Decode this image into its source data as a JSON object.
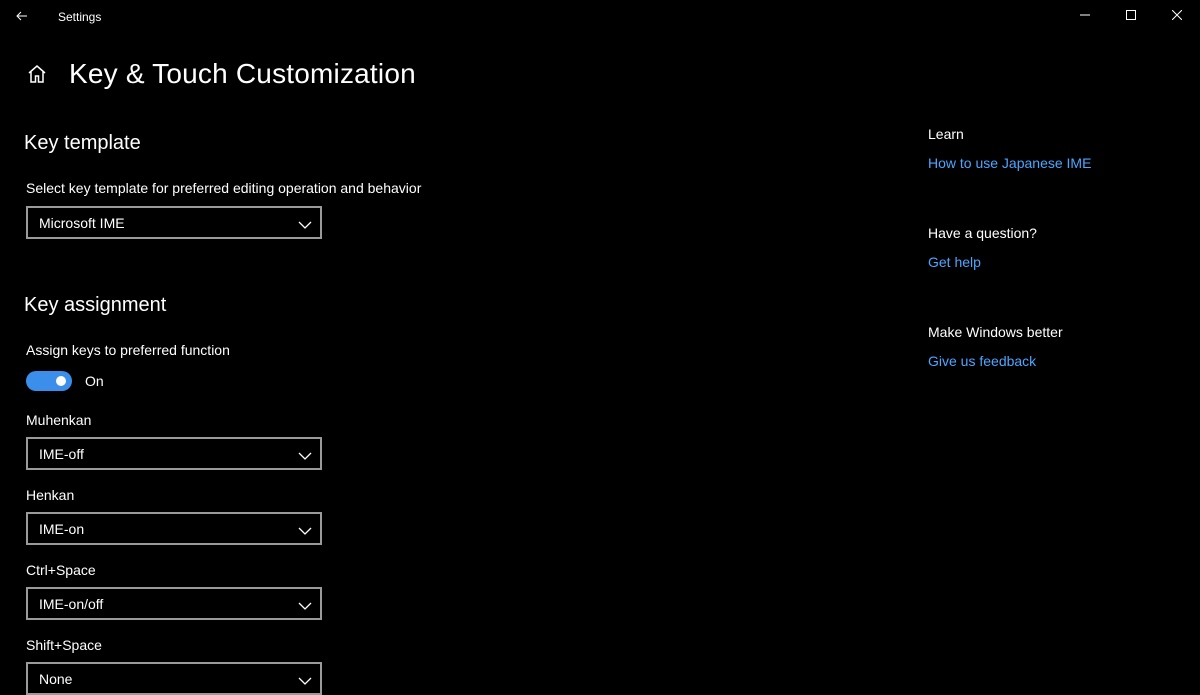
{
  "window": {
    "title": "Settings",
    "back_icon": "back-arrow-icon",
    "controls": [
      "minimize-icon",
      "maximize-icon",
      "close-icon"
    ]
  },
  "page": {
    "title": "Key & Touch Customization",
    "home_icon": "home-icon"
  },
  "key_template": {
    "heading": "Key template",
    "label": "Select key template for preferred editing operation and behavior",
    "selected": "Microsoft IME"
  },
  "key_assignment": {
    "heading": "Key assignment",
    "toggle_label": "Assign keys to preferred function",
    "toggle_state": "On",
    "toggle_on": true,
    "items": [
      {
        "label": "Muhenkan",
        "value": "IME-off"
      },
      {
        "label": "Henkan",
        "value": "IME-on"
      },
      {
        "label": "Ctrl+Space",
        "value": "IME-on/off"
      },
      {
        "label": "Shift+Space",
        "value": "None"
      }
    ]
  },
  "side": {
    "learn_heading": "Learn",
    "learn_link": "How to use Japanese IME",
    "question_heading": "Have a question?",
    "question_link": "Get help",
    "feedback_heading": "Make Windows better",
    "feedback_link": "Give us feedback"
  },
  "colors": {
    "background": "#000000",
    "accent": "#3b8eea",
    "link": "#4ca6ff",
    "dropdown_border": "#9a9a9a"
  }
}
